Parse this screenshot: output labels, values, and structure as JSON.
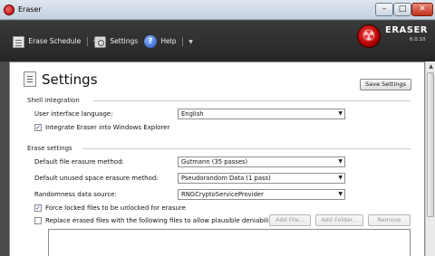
{
  "window": {
    "title": "Eraser",
    "min_glyph": "–",
    "max_glyph": "□",
    "close_glyph": "✕"
  },
  "toolbar": {
    "erase_schedule_label": "Erase Schedule",
    "settings_label": "Settings",
    "help_label": "Help",
    "help_glyph": "?",
    "dropdown_glyph": "▼"
  },
  "brand": {
    "name": "ERASER",
    "version": "6.0.10"
  },
  "page": {
    "title": "Settings",
    "save_button": "Save Settings"
  },
  "shell_integration": {
    "heading": "Shell integration",
    "language_label": "User interface language:",
    "language_value": "English",
    "integrate_label": "Integrate Eraser into Windows Explorer",
    "integrate_checked": true
  },
  "erase_settings": {
    "heading": "Erase settings",
    "file_method_label": "Default file erasure method:",
    "file_method_value": "Gutmann (35 passes)",
    "unused_method_label": "Default unused space erasure method:",
    "unused_method_value": "Pseudorandom Data (1 pass)",
    "randomness_label": "Randomness data source:",
    "randomness_value": "RNGCryptoServiceProvider",
    "force_unlock_label": "Force locked files to be unlocked for erasure",
    "force_unlock_checked": true,
    "replace_label": "Replace erased files with the following files to allow plausible deniability",
    "replace_checked": false,
    "add_file_button": "Add File...",
    "add_folder_button": "Add Folder...",
    "remove_button": "Remove"
  },
  "check_glyph": "✓",
  "combo_arrow_glyph": "▼",
  "scroll_up_glyph": "▲"
}
